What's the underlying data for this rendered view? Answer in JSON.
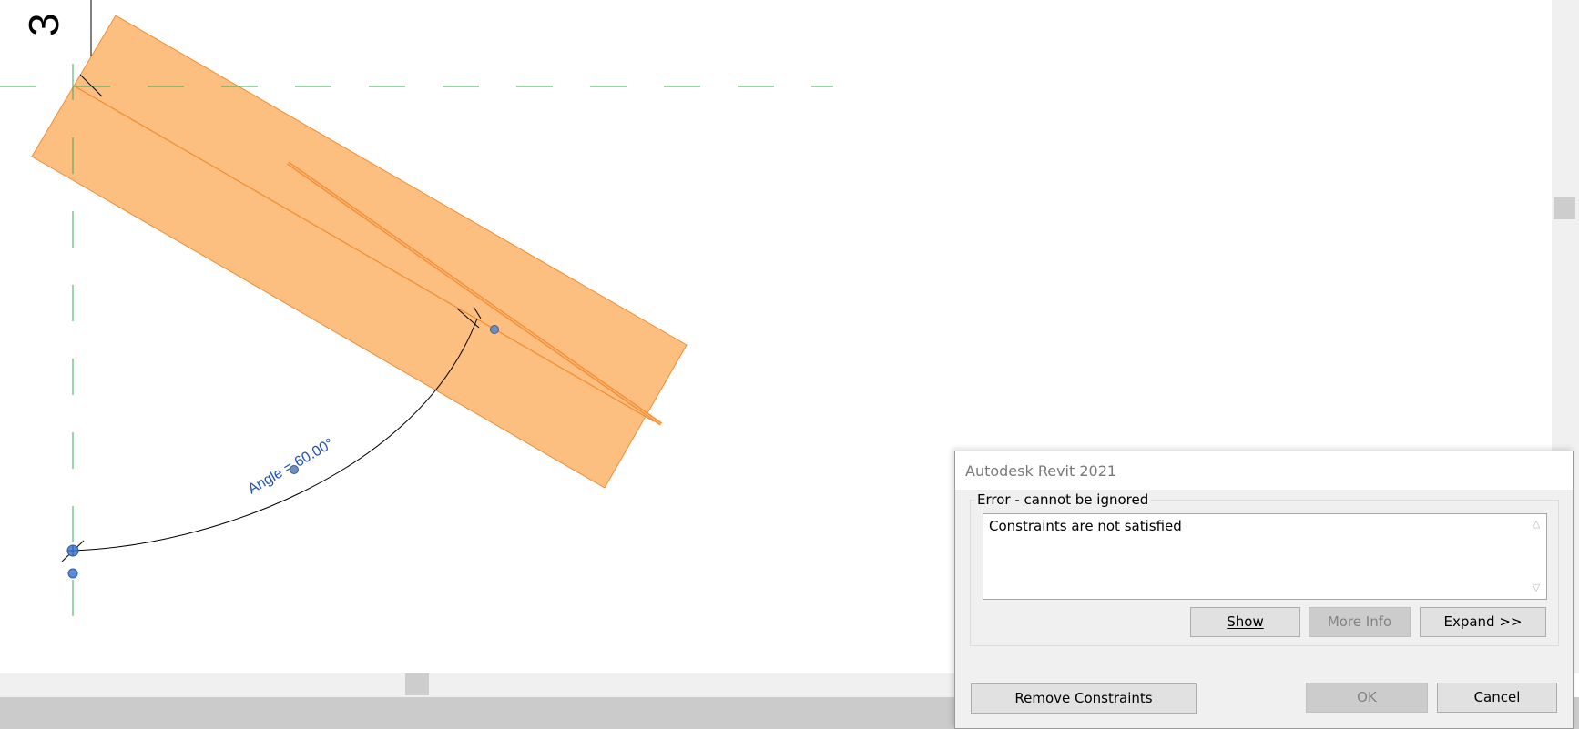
{
  "drawing": {
    "view_label": "3",
    "angle_dimension": "Angle = 60.00°",
    "colors": {
      "element_fill": "#fdbf80",
      "element_edge": "#f08c30",
      "reference_plane": "#3aa85a",
      "dimension_text": "#1f4fbf",
      "grip": "#5b8ad6"
    }
  },
  "dialog": {
    "title": "Autodesk Revit 2021",
    "group_label": "Error - cannot be ignored",
    "message": "Constraints are not satisfied",
    "buttons": {
      "show": "Show",
      "more_info": "More Info",
      "expand": "Expand >>",
      "remove_constraints": "Remove Constraints",
      "ok": "OK",
      "cancel": "Cancel"
    }
  }
}
